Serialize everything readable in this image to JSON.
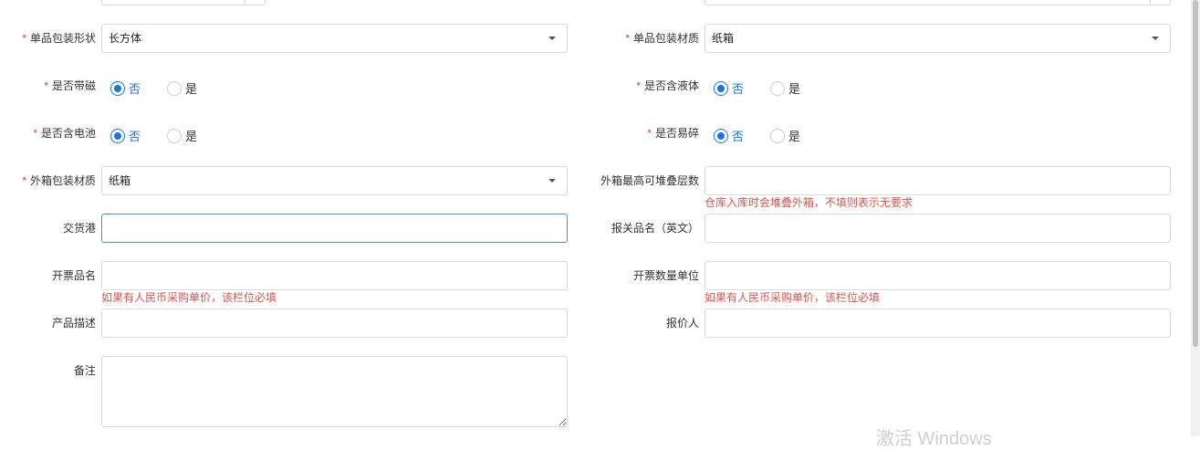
{
  "top_partial": {
    "field_left": "",
    "field_right": ""
  },
  "left": {
    "shape": {
      "label": "单品包装形状",
      "value": "长方体",
      "required": "*"
    },
    "magnetic": {
      "label": "是否带磁",
      "required": "*",
      "options": [
        "否",
        "是"
      ],
      "selected": "否"
    },
    "battery": {
      "label": "是否含电池",
      "required": "*",
      "options": [
        "否",
        "是"
      ],
      "selected": "否"
    },
    "outer_material": {
      "label": "外箱包装材质",
      "value": "纸箱",
      "required": "*"
    },
    "port": {
      "label": "交货港",
      "value": ""
    },
    "invoice_name": {
      "label": "开票品名",
      "value": "",
      "hint": "如果有人民币采购单价，该栏位必填"
    },
    "description": {
      "label": "产品描述",
      "value": ""
    },
    "remark": {
      "label": "备注",
      "value": ""
    }
  },
  "right": {
    "material": {
      "label": "单品包装材质",
      "value": "纸箱",
      "required": "*"
    },
    "liquid": {
      "label": "是否含液体",
      "required": "*",
      "options": [
        "否",
        "是"
      ],
      "selected": "否"
    },
    "fragile": {
      "label": "是否易碎",
      "required": "*",
      "options": [
        "否",
        "是"
      ],
      "selected": "否"
    },
    "stack_layers": {
      "label": "外箱最高可堆叠层数",
      "value": "",
      "hint": "仓库入库时会堆叠外箱，不填则表示无要求"
    },
    "customs_name_en": {
      "label": "报关品名（英文）",
      "value": ""
    },
    "invoice_unit": {
      "label": "开票数量单位",
      "value": "",
      "hint": "如果有人民币采购单价，该栏位必填"
    },
    "quoter": {
      "label": "报价人",
      "value": ""
    }
  },
  "watermark": "激活 Windows",
  "colors": {
    "accent": "#1a73e8",
    "required": "#e4393c",
    "hint": "#d9534f",
    "border": "#d9d9d9",
    "focus": "#4a90d9"
  }
}
